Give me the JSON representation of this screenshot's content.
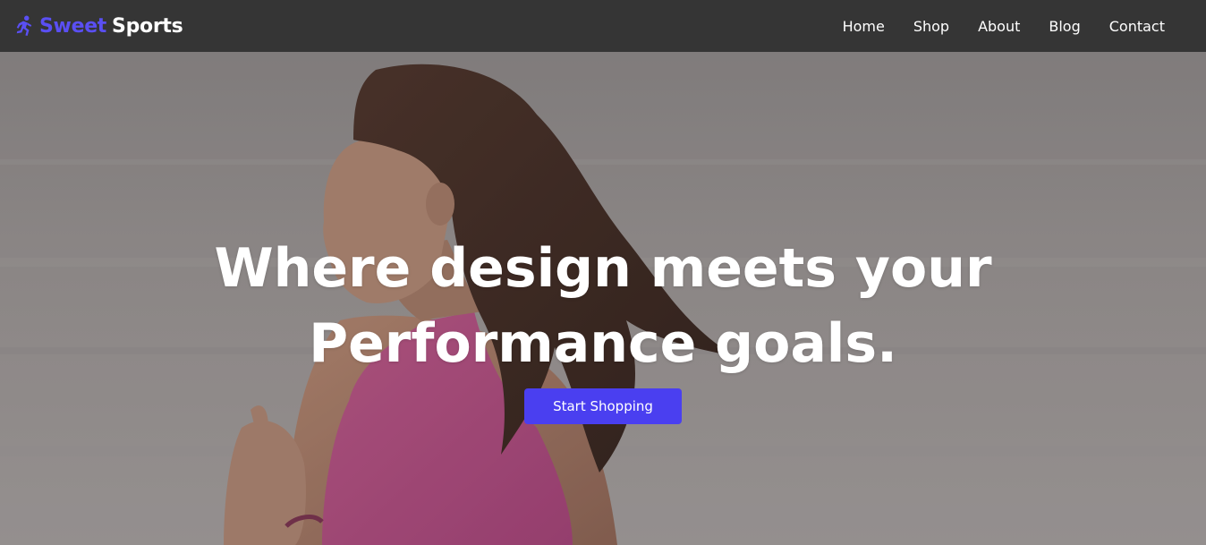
{
  "brand": {
    "icon": "running-person-icon",
    "name_part1": "Sweet",
    "name_part2": "Sports",
    "accent_color": "#5a4ff3"
  },
  "nav": {
    "items": [
      {
        "label": "Home"
      },
      {
        "label": "Shop"
      },
      {
        "label": "About"
      },
      {
        "label": "Blog"
      },
      {
        "label": "Contact"
      }
    ]
  },
  "hero": {
    "title": "Where design meets your Performance goals.",
    "cta_label": "Start Shopping",
    "cta_color": "#4a3ff0",
    "background_image": "woman-running-photo"
  }
}
